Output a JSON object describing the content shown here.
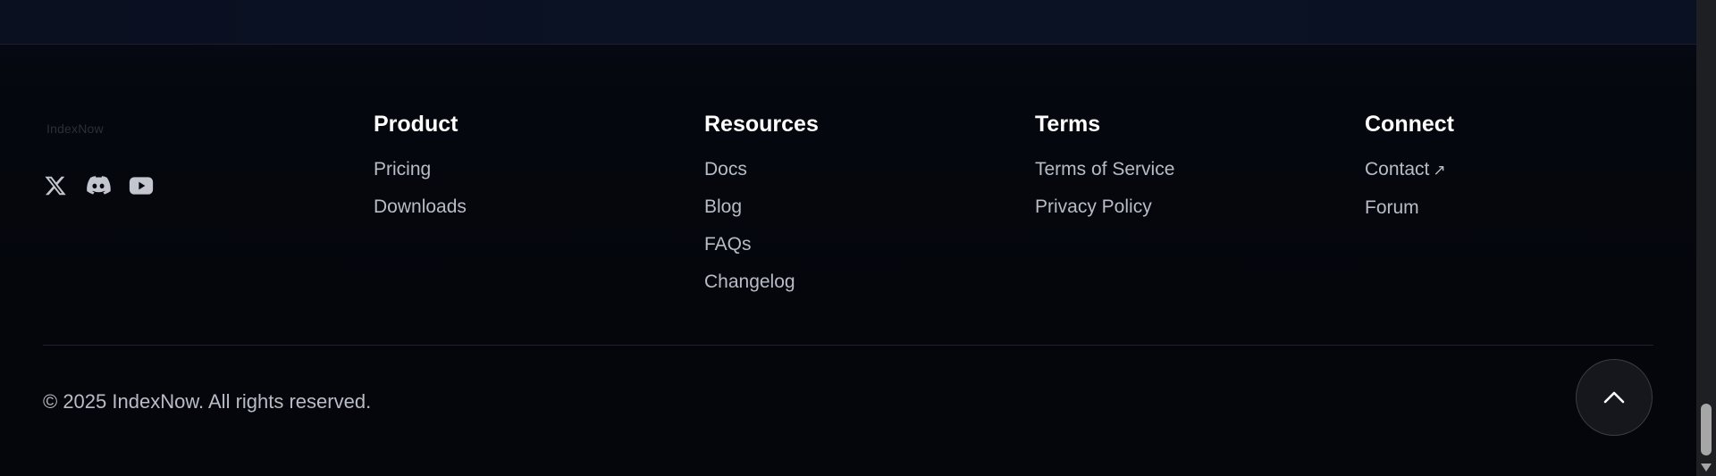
{
  "brand": {
    "logo_text": "IndexNow"
  },
  "socials": [
    {
      "icon": "x-twitter-icon"
    },
    {
      "icon": "discord-icon"
    },
    {
      "icon": "youtube-icon"
    }
  ],
  "columns": [
    {
      "title": "Product",
      "links": [
        "Pricing",
        "Downloads"
      ]
    },
    {
      "title": "Resources",
      "links": [
        "Docs",
        "Blog",
        "FAQs",
        "Changelog"
      ]
    },
    {
      "title": "Terms",
      "links": [
        "Terms of Service",
        "Privacy Policy"
      ]
    },
    {
      "title": "Connect",
      "links": [
        "Contact",
        "Forum"
      ],
      "external_marker": "↗"
    }
  ],
  "footer": {
    "copyright": "© 2025 IndexNow. All rights reserved."
  },
  "colors": {
    "background": "#05070d",
    "heading": "#ffffff",
    "link": "#b8bcc6",
    "icon": "#c3c6ce"
  }
}
